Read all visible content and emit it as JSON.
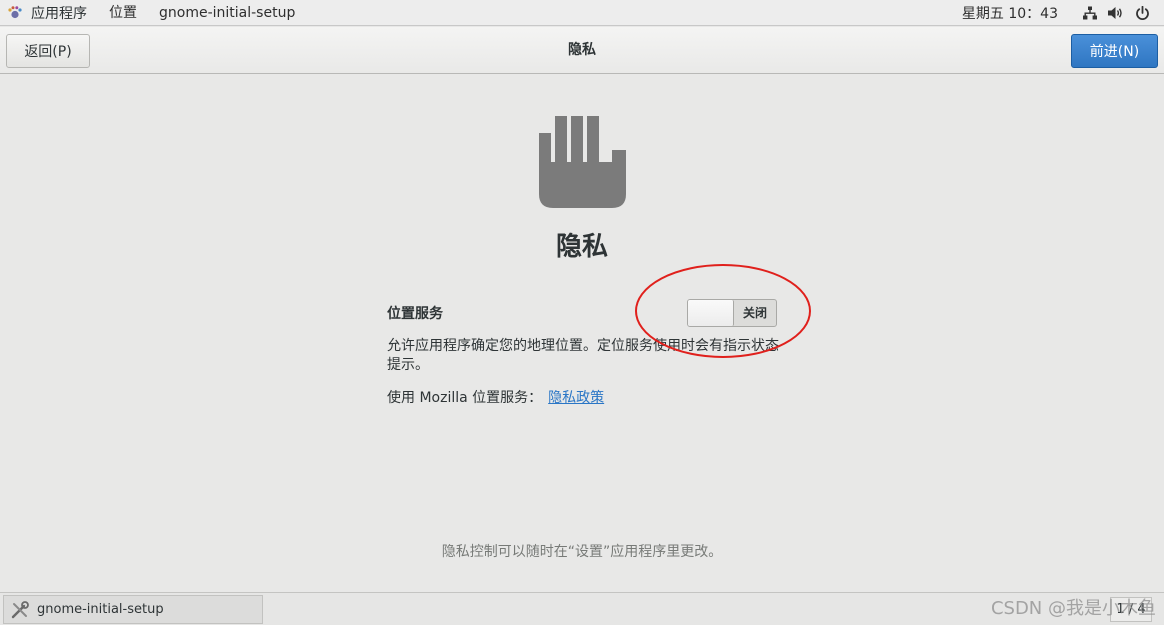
{
  "top_panel": {
    "apps_label": "应用程序",
    "places_label": "位置",
    "window_label": "gnome-initial-setup",
    "clock": "星期五 10：43",
    "icons": [
      "network-icon",
      "volume-icon",
      "power-icon"
    ]
  },
  "header": {
    "back_label": "返回(P)",
    "title": "隐私",
    "next_label": "前进(N)"
  },
  "main": {
    "heading": "隐私",
    "location_label": "位置服务",
    "toggle_state": "关闭",
    "description": "允许应用程序确定您的地理位置。定位服务使用时会有指示状态提示。",
    "mozilla_prefix": "使用  Mozilla 位置服务：",
    "privacy_link": "隐私政策",
    "footer_note": "隐私控制可以随时在“设置”应用程序里更改。"
  },
  "taskbar": {
    "window_label": "gnome-initial-setup",
    "workspace": "1 / 4"
  },
  "watermark": "CSDN @我是小木鱼",
  "colors": {
    "accent": "#2f76c2",
    "annotation": "#e0201c",
    "icon_gray": "#7b7b7b"
  }
}
